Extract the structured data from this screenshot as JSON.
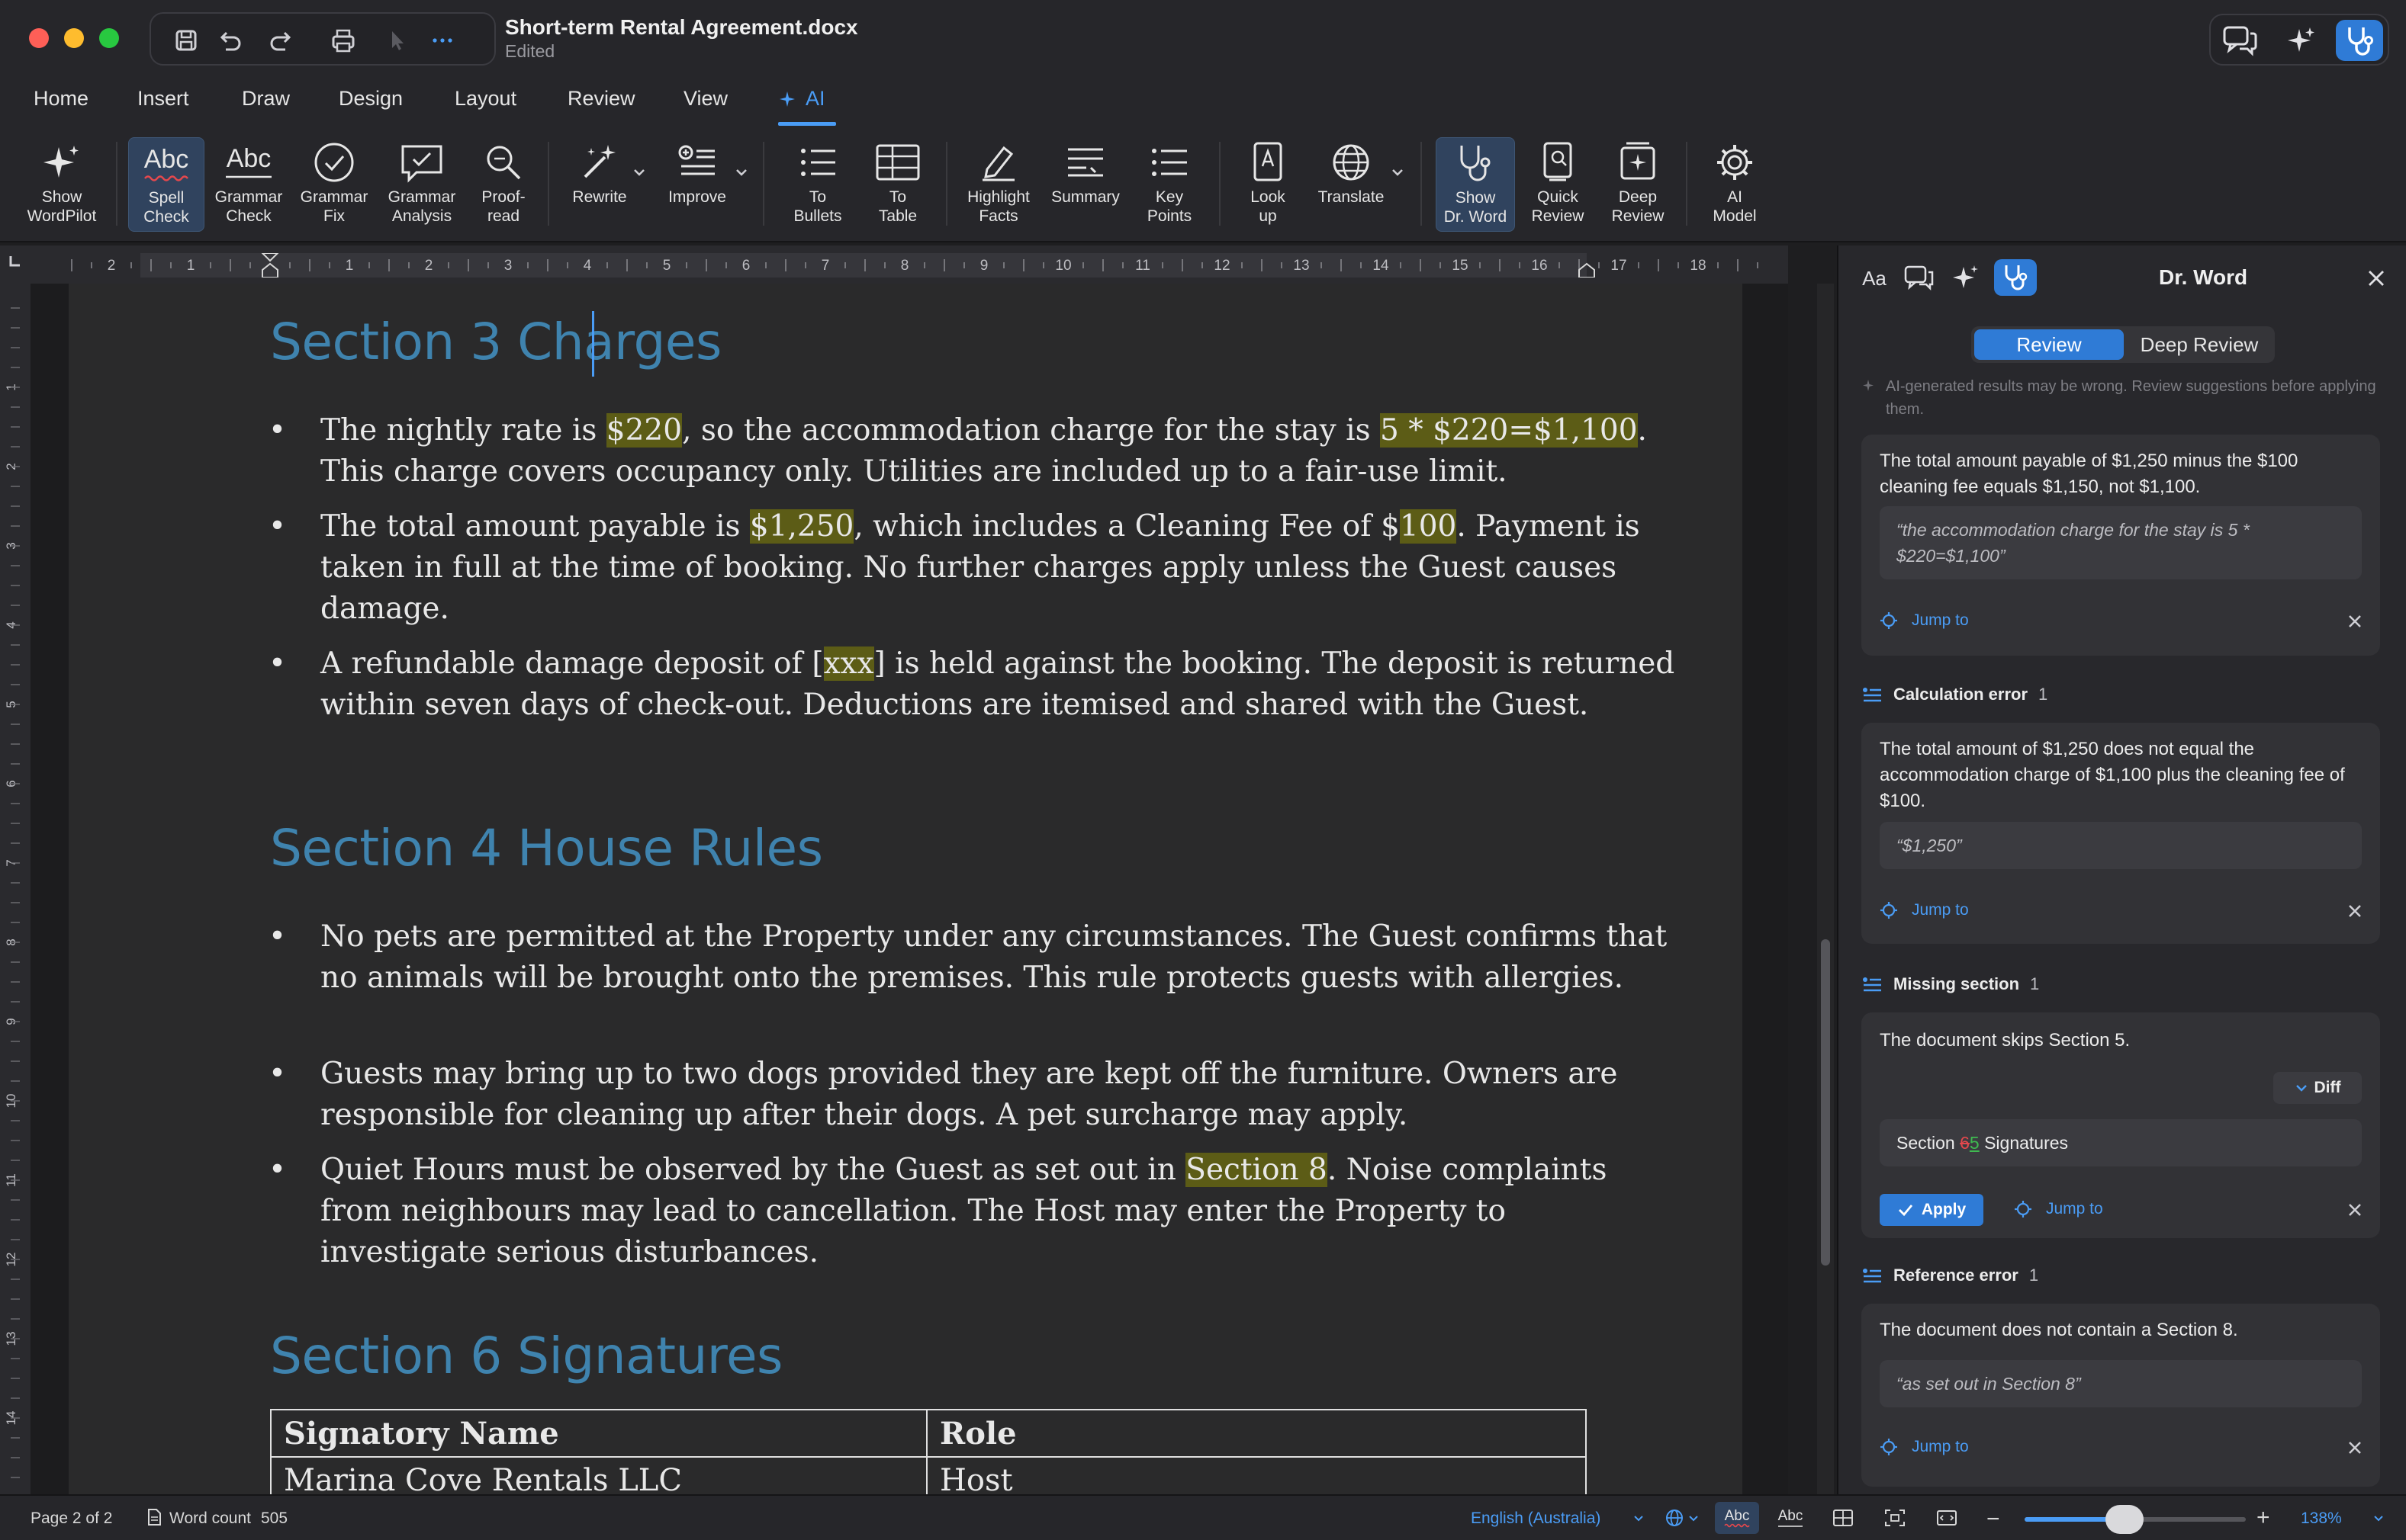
{
  "window": {
    "title": "Short-term Rental Agreement.docx",
    "status": "Edited"
  },
  "tabs": [
    "Home",
    "Insert",
    "Draw",
    "Design",
    "Layout",
    "Review",
    "View",
    "AI"
  ],
  "ribbon": {
    "show_wordpilot": "Show\nWordPilot",
    "spell_check": "Spell\nCheck",
    "grammar_check": "Grammar\nCheck",
    "grammar_fix": "Grammar\nFix",
    "grammar_analysis": "Grammar\nAnalysis",
    "proofread": "Proof-\nread",
    "rewrite": "Rewrite",
    "improve": "Improve",
    "to_bullets": "To\nBullets",
    "to_table": "To\nTable",
    "highlight_facts": "Highlight\nFacts",
    "summary": "Summary",
    "key_points": "Key\nPoints",
    "look_up": "Look\nup",
    "translate": "Translate",
    "show_dr_word": "Show\nDr. Word",
    "quick_review": "Quick\nReview",
    "deep_review": "Deep\nReview",
    "ai_model": "AI\nModel",
    "abc": "Abc"
  },
  "ruler": {
    "numbers": [
      "2",
      "1",
      "1",
      "2",
      "3",
      "4",
      "5",
      "6",
      "7",
      "8",
      "9",
      "10",
      "11",
      "12",
      "13",
      "14",
      "15",
      "16",
      "17",
      "18"
    ],
    "vnumbers": [
      "1",
      "2",
      "3",
      "4",
      "5",
      "6",
      "7",
      "8",
      "9",
      "10",
      "11",
      "12",
      "13",
      "14"
    ]
  },
  "document": {
    "section3": {
      "heading": "Section 3 Charges",
      "b1": {
        "t1": "The nightly rate is ",
        "h1": "$220",
        "t2": ", so the accommodation charge for the stay is ",
        "h2": "5 * $220=$1,100",
        "t3": ". This charge covers occupancy only. Utilities are included up to a fair-use limit."
      },
      "b2": {
        "t1": "The total amount payable is ",
        "h1": "$1,250",
        "t2": ", which includes a Cleaning Fee of $",
        "h2": "100",
        "t3": ". Payment is taken in full at the time of booking. No further charges apply unless the Guest causes damage."
      },
      "b3": {
        "t1": "A refundable damage deposit of [",
        "h1": "xxx",
        "t2": "] is held against the booking. The deposit is returned within seven days of check-out. Deductions are itemised and shared with the Guest."
      }
    },
    "section4": {
      "heading": "Section 4 House Rules",
      "b1": "No pets are permitted at the Property under any circumstances. The Guest confirms that no animals will be brought onto the premises. This rule protects guests with allergies.",
      "b2": "Guests may bring up to two dogs provided they are kept off the furniture. Owners are responsible for cleaning up after their dogs. A pet surcharge may apply.",
      "b3": {
        "t1": "Quiet Hours must be observed by the Guest as set out in ",
        "h1": "Section 8",
        "t2": ". Noise complaints from neighbours may lead to cancellation. The Host may enter the Property to investigate serious disturbances."
      }
    },
    "section6": {
      "heading": "Section 6 Signatures",
      "table": {
        "headers": [
          "Signatory Name",
          "Role"
        ],
        "rows": [
          [
            "Marina Cove Rentals LLC",
            "Host"
          ]
        ]
      }
    }
  },
  "panel": {
    "title": "Dr. Word",
    "tab_review": "Review",
    "tab_deep": "Deep Review",
    "disclaimer": "AI-generated results may be wrong. Review suggestions before applying them.",
    "jump_label": "Jump to",
    "apply_label": "Apply",
    "diff_label": "Diff",
    "card1": {
      "msg": "The total amount payable of $1,250 minus the $100 cleaning fee equals $1,150, not $1,100.",
      "quote": "“the accommodation charge for the stay is 5 * $220=$1,100”"
    },
    "cat2": {
      "name": "Calculation error",
      "count": "1"
    },
    "card2": {
      "msg": "The total amount of $1,250 does not equal the accommodation charge of $1,100 plus the cleaning fee of $100.",
      "quote": "“$1,250”"
    },
    "cat3": {
      "name": "Missing section",
      "count": "1"
    },
    "card3": {
      "msg": "The document skips Section 5.",
      "diff_pre": "Section ",
      "diff_old": "6",
      "diff_new": "5",
      "diff_post": " Signatures"
    },
    "cat4": {
      "name": "Reference error",
      "count": "1"
    },
    "card4": {
      "msg": "The document does not contain a Section 8.",
      "quote": "“as set out in Section 8”"
    }
  },
  "statusbar": {
    "page": "Page 2 of 2",
    "word_count_label": "Word count",
    "word_count": "505",
    "language": "English (Australia)",
    "zoom": "138%",
    "zoom_level": 0.45
  },
  "colors": {
    "accent": "#4a9cf5",
    "heading": "#3f83ae",
    "highlight": "#5c5c16"
  }
}
